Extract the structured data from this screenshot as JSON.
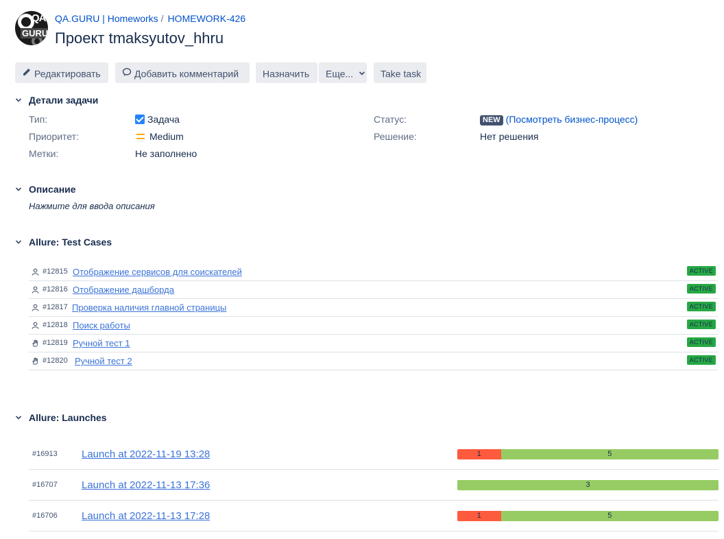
{
  "header": {
    "logo_text_top": "QA",
    "logo_text_bottom": "GURU",
    "breadcrumb_project": "QA.GURU | Homeworks",
    "breadcrumb_separator": "/",
    "breadcrumb_issue": "HOMEWORK-426",
    "title": "Проект tmaksyutov_hhru"
  },
  "toolbar": {
    "edit": "Редактировать",
    "comment": "Добавить комментарий",
    "assign": "Назначить",
    "more": "Еще...",
    "take_task": "Take task"
  },
  "details": {
    "heading": "Детали задачи",
    "type_label": "Тип:",
    "type_value": "Задача",
    "priority_label": "Приоритет:",
    "priority_value": "Medium",
    "labels_label": "Метки:",
    "labels_value": "Не заполнено",
    "status_label": "Статус:",
    "status_badge": "NEW",
    "status_open_paren": "(",
    "status_link": "Посмотреть бизнес-процесс",
    "status_close_paren": ")",
    "resolution_label": "Решение:",
    "resolution_value": "Нет решения"
  },
  "description": {
    "heading": "Описание",
    "placeholder": "Нажмите для ввода описания"
  },
  "test_cases": {
    "heading": "Allure: Test Cases",
    "items": [
      {
        "id": "#12815",
        "name": "Отображение сервисов для соискателей",
        "status": "ACTIVE",
        "kind": "automated"
      },
      {
        "id": "#12816",
        "name": "Отображение дашборда",
        "status": "ACTIVE",
        "kind": "automated"
      },
      {
        "id": "#12817",
        "name": "Проверка наличия главной страницы",
        "status": "ACTIVE",
        "kind": "automated"
      },
      {
        "id": "#12818",
        "name": "Поиск работы",
        "status": "ACTIVE",
        "kind": "automated"
      },
      {
        "id": "#12819",
        "name": "Ручной тест 1",
        "status": "ACTIVE",
        "kind": "manual"
      },
      {
        "id": "#12820",
        "name": "Ручной тест 2",
        "status": "ACTIVE",
        "kind": "manual"
      }
    ]
  },
  "launches": {
    "heading": "Allure: Launches",
    "items": [
      {
        "id": "#16913",
        "name": "Launch at 2022-11-19 13:28",
        "failed": 1,
        "passed": 5
      },
      {
        "id": "#16707",
        "name": "Launch at 2022-11-13 17:36",
        "failed": 0,
        "passed": 3
      },
      {
        "id": "#16706",
        "name": "Launch at 2022-11-13 17:28",
        "failed": 1,
        "passed": 5
      }
    ]
  },
  "colors": {
    "link": "#0052cc",
    "failed": "#fd5a3e",
    "passed": "#97cc64",
    "status_active": "#27a844",
    "priority_medium": "#ffab00",
    "checkbox": "#2684ff"
  }
}
